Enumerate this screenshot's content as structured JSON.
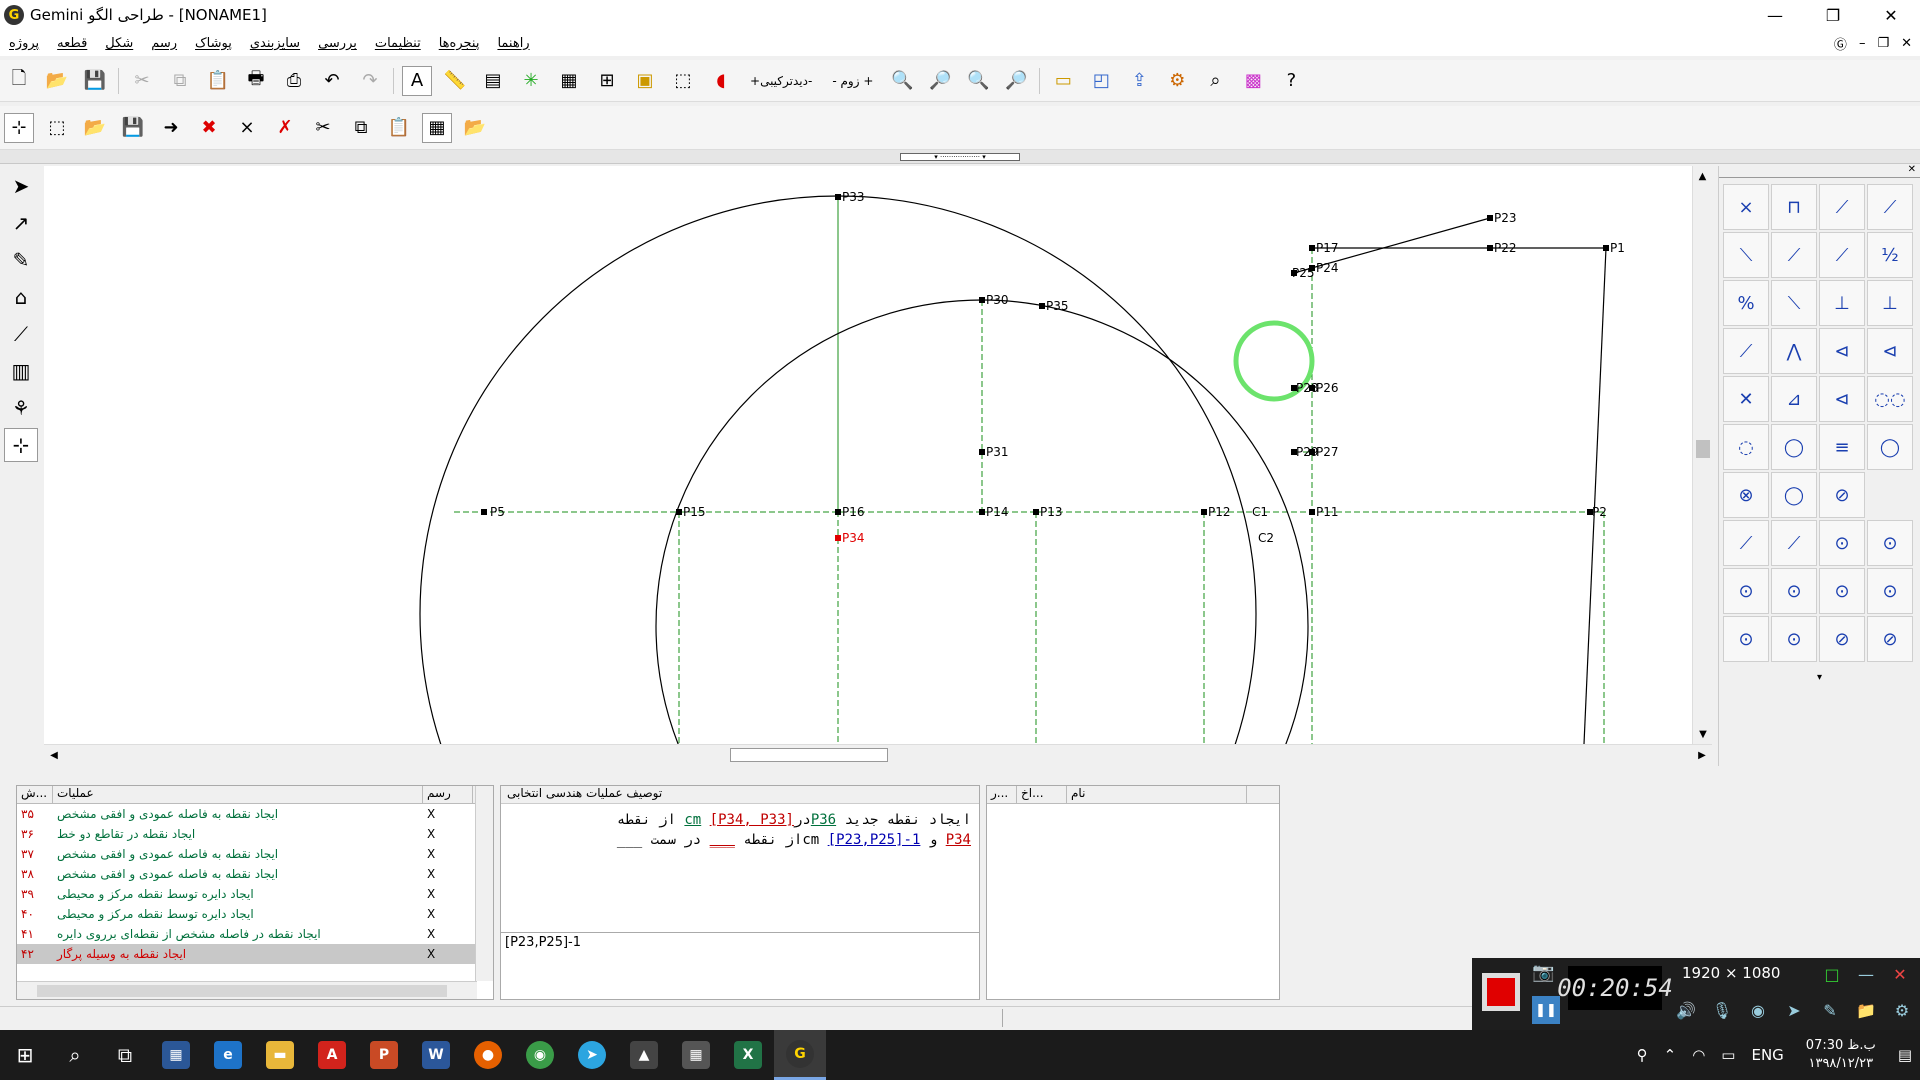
{
  "window": {
    "title": "Gemini طراحی الگو  - [NONAME1]",
    "minimize": "—",
    "restore": "❐",
    "close": "✕"
  },
  "menu": [
    "پروژه",
    "قطعه",
    "شکل",
    "رسم",
    "پوشاک",
    "سایزبندی",
    "بررسی",
    "تنظیمات",
    "پنجره‌ها",
    "راهنما"
  ],
  "toolbar": {
    "text_detail": "+دیدترکیبی-",
    "text_zoom": "- زوم +"
  },
  "canvas": {
    "points": [
      {
        "id": "P33"
      },
      {
        "id": "P30"
      },
      {
        "id": "P35"
      },
      {
        "id": "P31"
      },
      {
        "id": "P5"
      },
      {
        "id": "P15"
      },
      {
        "id": "P16"
      },
      {
        "id": "P14"
      },
      {
        "id": "P13"
      },
      {
        "id": "P12"
      },
      {
        "id": "P11"
      },
      {
        "id": "P34"
      },
      {
        "id": "P23"
      },
      {
        "id": "P17"
      },
      {
        "id": "P22"
      },
      {
        "id": "P1"
      },
      {
        "id": "P25"
      },
      {
        "id": "P24"
      },
      {
        "id": "P27"
      },
      {
        "id": "P28"
      },
      {
        "id": "P26"
      },
      {
        "id": "P29"
      },
      {
        "id": "P2"
      }
    ],
    "curve_labels": [
      "C1",
      "C2"
    ]
  },
  "operations_panel": {
    "headers": {
      "num": "ش...",
      "op": "عملیات",
      "draw": "رسم"
    },
    "rows": [
      {
        "num": "۳۵",
        "op": "ایجاد نقطه به فاصله عمودی و افقی مشخص",
        "draw": "X"
      },
      {
        "num": "۳۶",
        "op": "ایجاد نقطه در تقاطع دو خط",
        "draw": "X"
      },
      {
        "num": "۳۷",
        "op": "ایجاد نقطه به فاصله عمودی و افقی مشخص",
        "draw": "X"
      },
      {
        "num": "۳۸",
        "op": "ایجاد نقطه به فاصله عمودی و افقی مشخص",
        "draw": "X"
      },
      {
        "num": "۳۹",
        "op": "ایجاد دایره توسط نقطه مرکز و محیطی",
        "draw": "X"
      },
      {
        "num": "۴۰",
        "op": "ایجاد دایره توسط نقطه مرکز و محیطی",
        "draw": "X"
      },
      {
        "num": "۴۱",
        "op": "ایجاد نقطه در فاصله مشخص از نقطه‌ای برروی دایره",
        "draw": "X"
      },
      {
        "num": "۴۲",
        "op": "ایجاد نقطه به وسیله پرگار",
        "draw": "X"
      }
    ]
  },
  "description_panel": {
    "title": "توصیف عملیات هندسی انتخابی",
    "line1_a": "ایجاد نقطه جدید",
    "line1_b": "P36",
    "line1_c": "در",
    "line1_d": "cm",
    "line1_e": "[P34, P33]",
    "line1_f": "از نقطه",
    "line2_a": "P34",
    "line2_b": "و",
    "line2_c": "cm",
    "line2_d": "[P23,P25]-1",
    "line2_e": "از نقطه",
    "line2_f": "در سمت",
    "input_value": "[P23,P25]-1"
  },
  "names_panel": {
    "headers": [
      "نام",
      "اخ...",
      "ر..."
    ]
  },
  "recorder": {
    "time": "00:20:54",
    "resolution": "1920 × 1080"
  },
  "taskbar": {
    "language": "ENG",
    "time": "07:30 ب.ظ",
    "date": "۱۳۹۸/۱۲/۲۳"
  },
  "colors": {
    "guide_green": "#1a8f1a",
    "point_red": "#e00000",
    "selection_ring": "#6ce36c"
  }
}
